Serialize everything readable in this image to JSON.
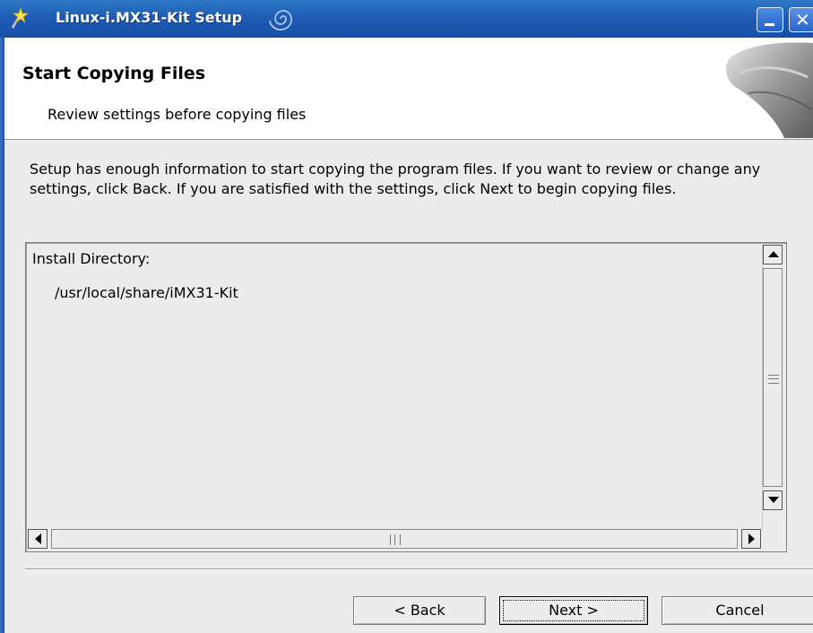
{
  "window": {
    "title": "Linux-i.MX31-Kit Setup",
    "icons": [
      "wand-icon",
      "swirl-icon",
      "minimize-icon",
      "close-icon"
    ],
    "close_glyph": "✕",
    "colors": {
      "titlebar": "#1f5cb4",
      "body": "#ececec"
    }
  },
  "header": {
    "title": "Start Copying Files",
    "subtitle": "Review settings before copying files"
  },
  "body": {
    "intro": "Setup has enough information to start copying the program files.  If you want to review or change any settings, click Back.  If you are satisfied with the settings, click Next to begin copying files.",
    "info": {
      "label": "Install Directory:",
      "value": "/usr/local/share/iMX31-Kit"
    }
  },
  "buttons": {
    "back": "< Back",
    "next": "Next >",
    "cancel": "Cancel"
  }
}
